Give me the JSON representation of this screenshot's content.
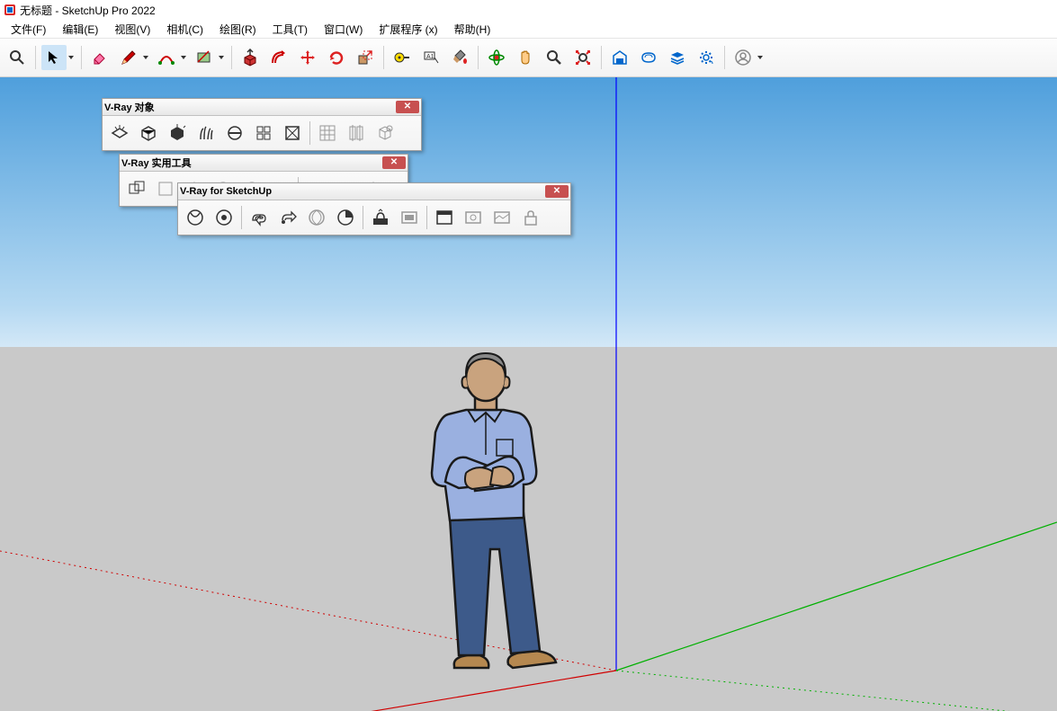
{
  "window": {
    "title": "无标题 - SketchUp Pro 2022"
  },
  "menus": {
    "file": "文件(F)",
    "edit": "编辑(E)",
    "view": "视图(V)",
    "camera": "相机(C)",
    "draw": "绘图(R)",
    "tools": "工具(T)",
    "window": "窗口(W)",
    "extensions": "扩展程序 (x)",
    "help": "帮助(H)"
  },
  "toolbar": {
    "items": [
      {
        "name": "search-icon",
        "type": "icon"
      },
      {
        "name": "select-tool",
        "type": "dropdown",
        "active": true
      },
      {
        "name": "eraser-tool",
        "type": "icon"
      },
      {
        "name": "pencil-tool",
        "type": "dropdown"
      },
      {
        "name": "arc-tool",
        "type": "dropdown"
      },
      {
        "name": "shape-tool",
        "type": "dropdown"
      },
      {
        "name": "pushpull-tool",
        "type": "icon"
      },
      {
        "name": "offset-tool",
        "type": "icon"
      },
      {
        "name": "move-tool",
        "type": "icon"
      },
      {
        "name": "rotate-tool",
        "type": "icon"
      },
      {
        "name": "scale-tool",
        "type": "icon"
      },
      {
        "name": "tape-measure-tool",
        "type": "icon"
      },
      {
        "name": "text-tool",
        "type": "icon"
      },
      {
        "name": "paint-bucket-tool",
        "type": "icon"
      },
      {
        "name": "orbit-tool",
        "type": "icon"
      },
      {
        "name": "pan-tool",
        "type": "icon"
      },
      {
        "name": "zoom-tool",
        "type": "icon"
      },
      {
        "name": "zoom-extents-tool",
        "type": "icon"
      },
      {
        "name": "warehouse-icon",
        "type": "icon"
      },
      {
        "name": "extension-warehouse-icon",
        "type": "icon"
      },
      {
        "name": "layers-icon",
        "type": "icon"
      },
      {
        "name": "settings-gear-icon",
        "type": "icon"
      },
      {
        "name": "user-account-icon",
        "type": "dropdown"
      }
    ]
  },
  "panels": {
    "vray_objects": {
      "title": "V-Ray 对象",
      "buttons": [
        "light-plane-icon",
        "light-dome-icon",
        "light-sphere-icon",
        "fur-icon",
        "clipper-icon",
        "proxy-icon",
        "mesh-light-icon",
        "grid-icon",
        "infinite-plane-icon",
        "geometry-icon"
      ]
    },
    "vray_util": {
      "title": "V-Ray 实用工具",
      "buttons": [
        "util-1-icon",
        "util-2-icon",
        "util-3-icon",
        "util-4-icon",
        "util-5-icon",
        "util-6-icon",
        "util-7-icon",
        "util-8-icon",
        "util-9-icon"
      ]
    },
    "vray_main": {
      "title": "V-Ray for SketchUp",
      "buttons": [
        "asset-editor-icon",
        "render-icon",
        "render-rt-icon",
        "render-viewport-icon",
        "render-cloud-icon",
        "render-stop-icon",
        "vfb-icon",
        "batch-render-icon",
        "frame-buffer-icon",
        "chaos-cloud-icon",
        "cosmos-icon",
        "lock-icon"
      ]
    }
  },
  "viewport": {
    "axes": {
      "z_color": "#0000ff",
      "x_color": "#d00000",
      "y_color": "#00b000"
    },
    "figure": "default-person"
  }
}
